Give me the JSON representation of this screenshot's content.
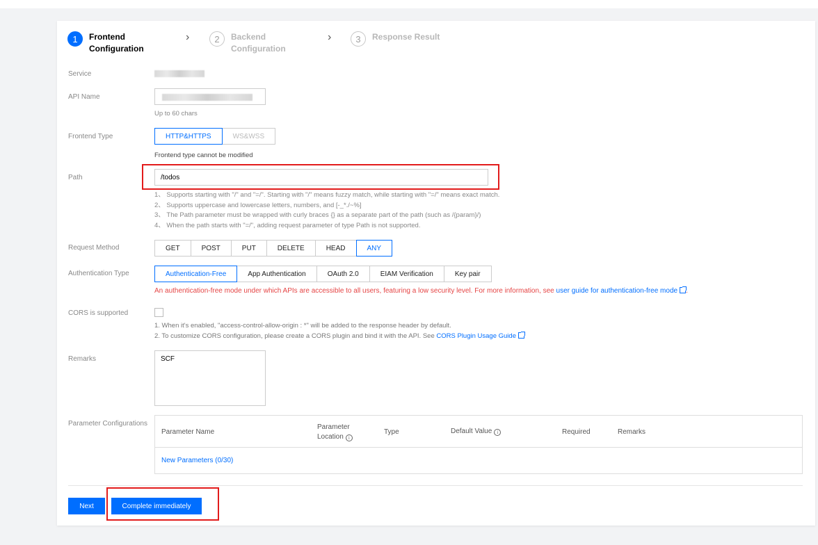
{
  "steps": [
    {
      "num": "1",
      "label_line1": "Frontend",
      "label_line2": "Configuration"
    },
    {
      "num": "2",
      "label_line1": "Backend",
      "label_line2": "Configuration"
    },
    {
      "num": "3",
      "label_line1": "Response Result",
      "label_line2": ""
    }
  ],
  "form": {
    "service_label": "Service",
    "api_name_label": "API Name",
    "api_name_hint": "Up to 60 chars",
    "frontend_type_label": "Frontend Type",
    "frontend_types": [
      "HTTP&HTTPS",
      "WS&WSS"
    ],
    "frontend_type_hint": "Frontend type cannot be modified",
    "path_label": "Path",
    "path_value": "/todos",
    "path_hints": [
      "1、 Supports starting with \"/\" and \"=/\". Starting with \"/\" means fuzzy match, while starting with \"=/\" means exact match.",
      "2、 Supports uppercase and lowercase letters, numbers, and [-_*./~%]",
      "3、 The Path parameter must be wrapped with curly braces {} as a separate part of the path (such as /{param}/)",
      "4、 When the path starts with \"=/\", adding request parameter of type Path is not supported."
    ],
    "request_method_label": "Request Method",
    "methods": [
      "GET",
      "POST",
      "PUT",
      "DELETE",
      "HEAD",
      "ANY"
    ],
    "auth_type_label": "Authentication Type",
    "auth_types": [
      "Authentication-Free",
      "App Authentication",
      "OAuth 2.0",
      "EIAM Verification",
      "Key pair"
    ],
    "auth_warning": "An authentication-free mode under which APIs are accessible to all users, featuring a low security level. For more information, see ",
    "auth_warning_link": "user guide for authentication-free mode",
    "auth_warning_end": ".",
    "cors_label": "CORS is supported",
    "cors_hint1": "1. When it's enabled, \"access-control-allow-origin : *\" will be added to the response header by default.",
    "cors_hint2": "2. To customize CORS configuration, please create a CORS plugin and bind it with the API. See ",
    "cors_hint2_link": "CORS Plugin Usage Guide",
    "remarks_label": "Remarks",
    "remarks_value": "SCF",
    "param_config_label": "Parameter Configurations"
  },
  "param_table": {
    "col_name": "Parameter Name",
    "col_location_1": "Parameter",
    "col_location_2": "Location",
    "col_type": "Type",
    "col_default": "Default Value",
    "col_required": "Required",
    "col_remarks": "Remarks",
    "add_link": "New Parameters (0/30)"
  },
  "buttons": {
    "next": "Next",
    "complete": "Complete immediately"
  },
  "colors": {
    "accent": "#006eff",
    "warning": "#e54545",
    "highlight_box": "#e21b1b"
  }
}
